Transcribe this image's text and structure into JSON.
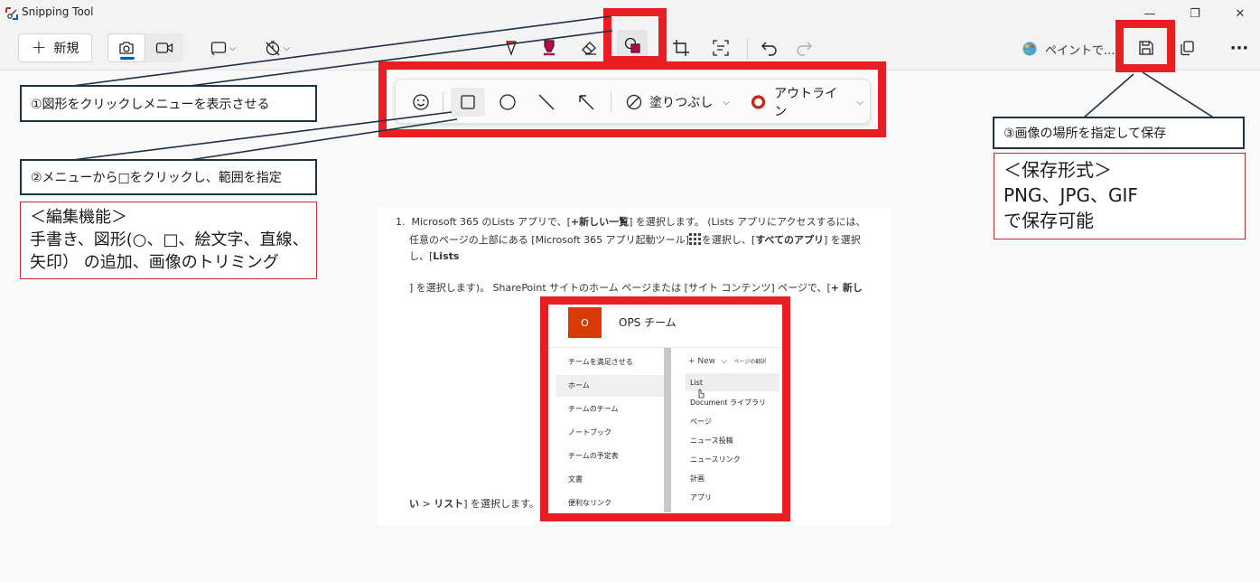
{
  "window": {
    "title": "Snipping Tool",
    "minimize_glyph": "—",
    "maximize_glyph": "❐",
    "close_glyph": "✕"
  },
  "toolbar": {
    "new_label": "新規",
    "new_icon": "plus-icon",
    "paint_label": "ペイントで...",
    "more_glyph": "···",
    "icons": [
      "camera-icon",
      "video-icon",
      "snip-mode-icon",
      "timer-icon",
      "ballpoint-pen-icon",
      "highlighter-icon",
      "eraser-icon",
      "shapes-icon",
      "crop-icon",
      "text-actions-icon",
      "undo-icon",
      "redo-icon",
      "paint-icon",
      "save-icon",
      "copy-icon",
      "more-icon"
    ]
  },
  "shape_menu": {
    "fill_label": "塗りつぶし",
    "outline_label": "アウトライン",
    "icons": [
      "emoji-icon",
      "rectangle-icon",
      "circle-icon",
      "line-icon",
      "arrow-icon",
      "fill-icon",
      "outline-icon"
    ]
  },
  "callouts": {
    "step1": "①図形をクリックしメニューを表示させる",
    "step2": "②メニューから□をクリックし、範囲を指定",
    "step3": "③画像の場所を指定して保存"
  },
  "edit_box": {
    "lines": [
      "＜編集機能＞",
      "手書き、図形(○、□、絵文字、直線、",
      "矢印） の追加、画像のトリミング"
    ]
  },
  "save_box": {
    "lines": [
      "＜保存形式＞",
      "PNG、JPG、GIF",
      "で保存可能"
    ]
  },
  "document": {
    "item_number": "1.",
    "line1_a": "Microsoft 365 のLists アプリで、[",
    "line1_b": "+新しい一覧",
    "line1_c": "] を選択します。 (Lists アプリにアクセスするには、",
    "line2_a": "任意のページの上部にある [Microsoft 365 アプリ起動ツール]",
    "line2_b": "を選択し、[",
    "line2_c": "すべてのアプリ",
    "line2_d": "] を選択",
    "line3_a": "し、[",
    "line3_b": "Lists",
    "line4_a": "] を選択します)。 SharePoint サイトのホーム ページまたは [サイト コンテンツ] ページで、[",
    "line4_b": "+ 新し",
    "line5_a": "い",
    "line5_b": " > ",
    "line5_c": "リスト",
    "line5_d": "] を選択します。"
  },
  "sharepoint": {
    "logo_letter": "O",
    "site_title": "OPS チーム",
    "new_label": "+ New",
    "page_label": "ページの翻訳",
    "nav_items": [
      "チームを満足させる",
      "ホーム",
      "チームのチーム",
      "ノートブック",
      "チームの予定表",
      "文書",
      "便利なリンク"
    ],
    "new_menu_items": [
      "List",
      "Document ライブラリ",
      "ページ",
      "ニュース投稿",
      "ニュースリンク",
      "計画",
      "アプリ"
    ]
  },
  "colors": {
    "highlight_red": "#e81e23",
    "callout_border": "#1f3347",
    "infobox_border": "#c0302e",
    "accent_blue": "#005fb8",
    "pen_red": "#c42b1c",
    "highlighter_magenta": "#c30052",
    "sharepoint_orange": "#d83b01"
  }
}
